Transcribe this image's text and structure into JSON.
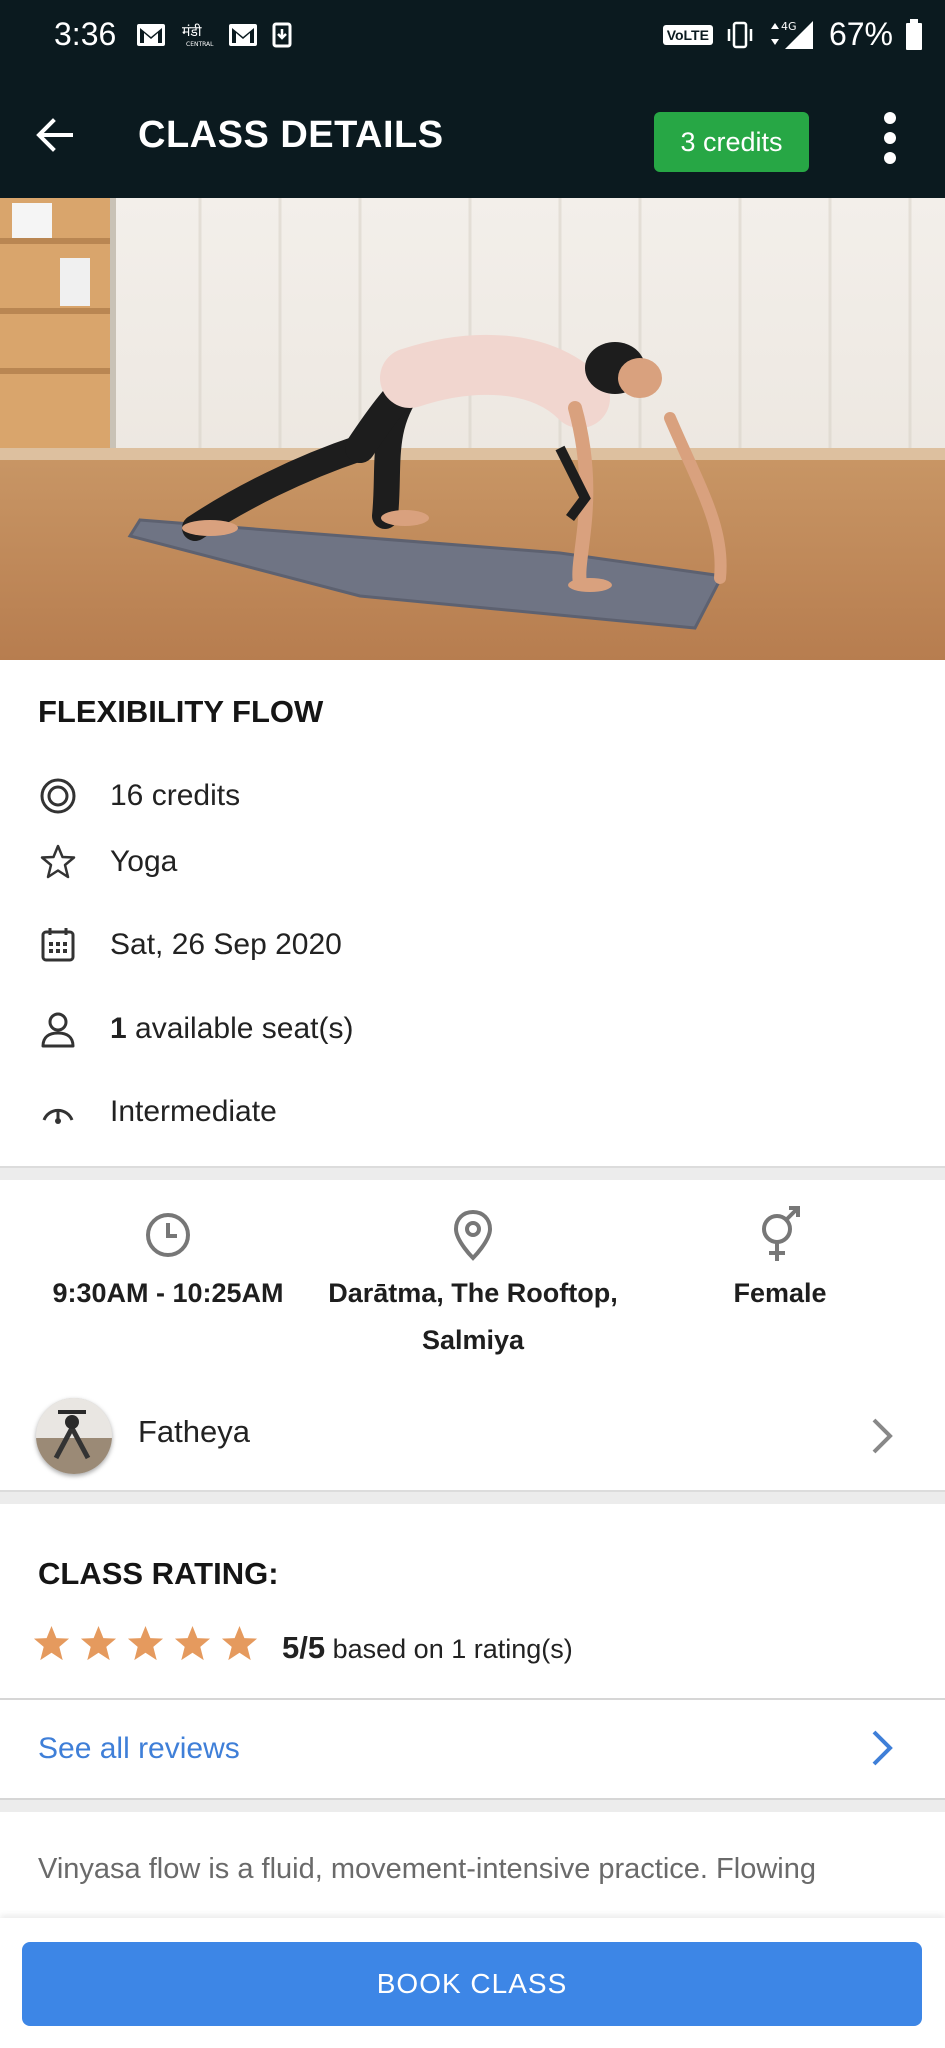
{
  "status_bar": {
    "time": "3:36",
    "network_badge": "VoLTE",
    "network_type": "4G",
    "battery": "67%"
  },
  "app_bar": {
    "title": "CLASS DETAILS",
    "credits_badge": "3 credits"
  },
  "class": {
    "name": "FLEXIBILITY FLOW",
    "credits": "16 credits",
    "category": "Yoga",
    "date": "Sat, 26 Sep 2020",
    "seats_count": "1",
    "seats_label": " available seat(s)",
    "level": "Intermediate"
  },
  "meta": {
    "time": "9:30AM - 10:25AM",
    "location_line1": "Darātma, The Rooftop,",
    "location_line2": "Salmiya",
    "gender": "Female"
  },
  "instructor": {
    "name": "Fatheya"
  },
  "rating": {
    "title": "CLASS RATING:",
    "score": "5/5",
    "based_on": " based on 1 rating(s)",
    "stars_filled": 5,
    "stars_total": 5,
    "star_color": "#e59a5e"
  },
  "reviews": {
    "link_label": "See all reviews"
  },
  "description": {
    "text": "Vinyasa flow is a fluid, movement-intensive practice. Flowing"
  },
  "footer": {
    "book_label": "BOOK CLASS"
  },
  "colors": {
    "header_bg": "#0b1a1f",
    "credits_badge": "#27a745",
    "link_blue": "#3f7fd8",
    "book_button": "#3d86e6"
  }
}
